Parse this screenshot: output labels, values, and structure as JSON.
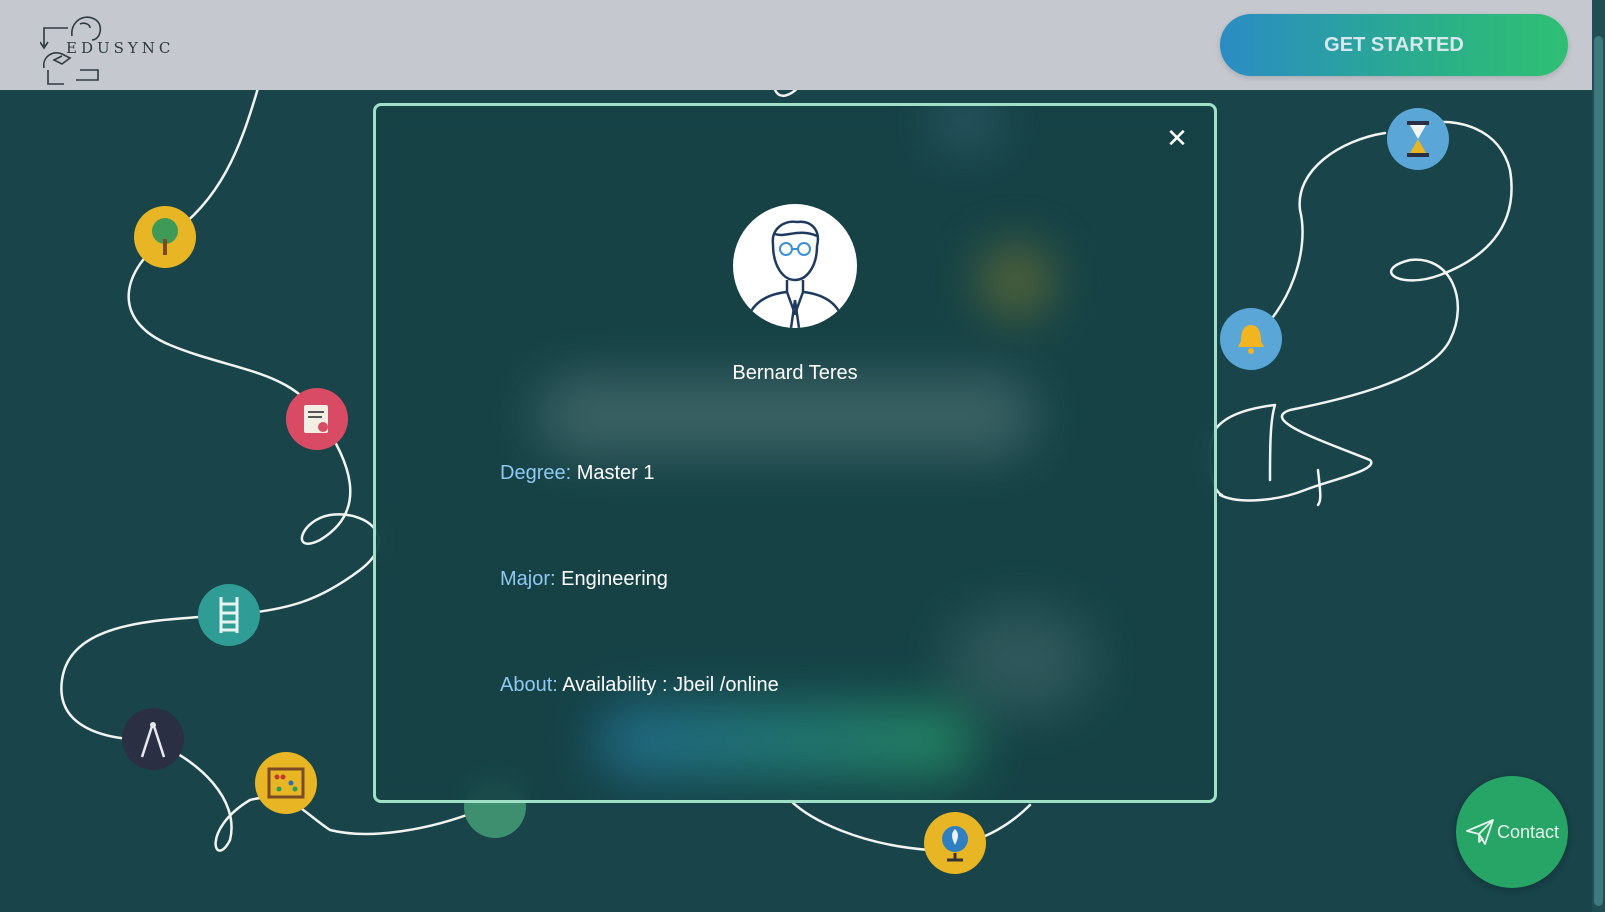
{
  "brand": {
    "name": "EDUSYNC",
    "logo_icon": "head-graduation-cap-icon"
  },
  "header": {
    "cta_label": "GET STARTED"
  },
  "profile_modal": {
    "close_icon": "close-icon",
    "avatar_icon": "person-with-glasses-avatar",
    "name": "Bernard Teres",
    "fields": [
      {
        "label": "Degree:",
        "value": "Master 1"
      },
      {
        "label": "Major:",
        "value": "Engineering"
      },
      {
        "label": "About:",
        "value": "Availability : Jbeil /online"
      }
    ]
  },
  "contact": {
    "label": "Contact",
    "icon": "paper-plane-icon"
  },
  "background_nodes": [
    {
      "icon": "tree-icon",
      "color": "#e8b524"
    },
    {
      "icon": "certificate-icon",
      "color": "#d94a64"
    },
    {
      "icon": "ladder-icon",
      "color": "#2f9c95"
    },
    {
      "icon": "compass-icon",
      "color": "#2b2f44"
    },
    {
      "icon": "abacus-icon",
      "color": "#e8b524"
    },
    {
      "icon": "book-icon",
      "color": "#3e8f6f"
    },
    {
      "icon": "globe-icon",
      "color": "#e8b524"
    },
    {
      "icon": "hourglass-icon",
      "color": "#5aa6d6"
    },
    {
      "icon": "bell-icon",
      "color": "#5aa6d6"
    }
  ],
  "colors": {
    "background": "#18444a",
    "header": "#c5c9cf",
    "modal_border": "#9fe0c6",
    "label_blue": "#8fc8f2",
    "contact_green": "#27a566"
  }
}
